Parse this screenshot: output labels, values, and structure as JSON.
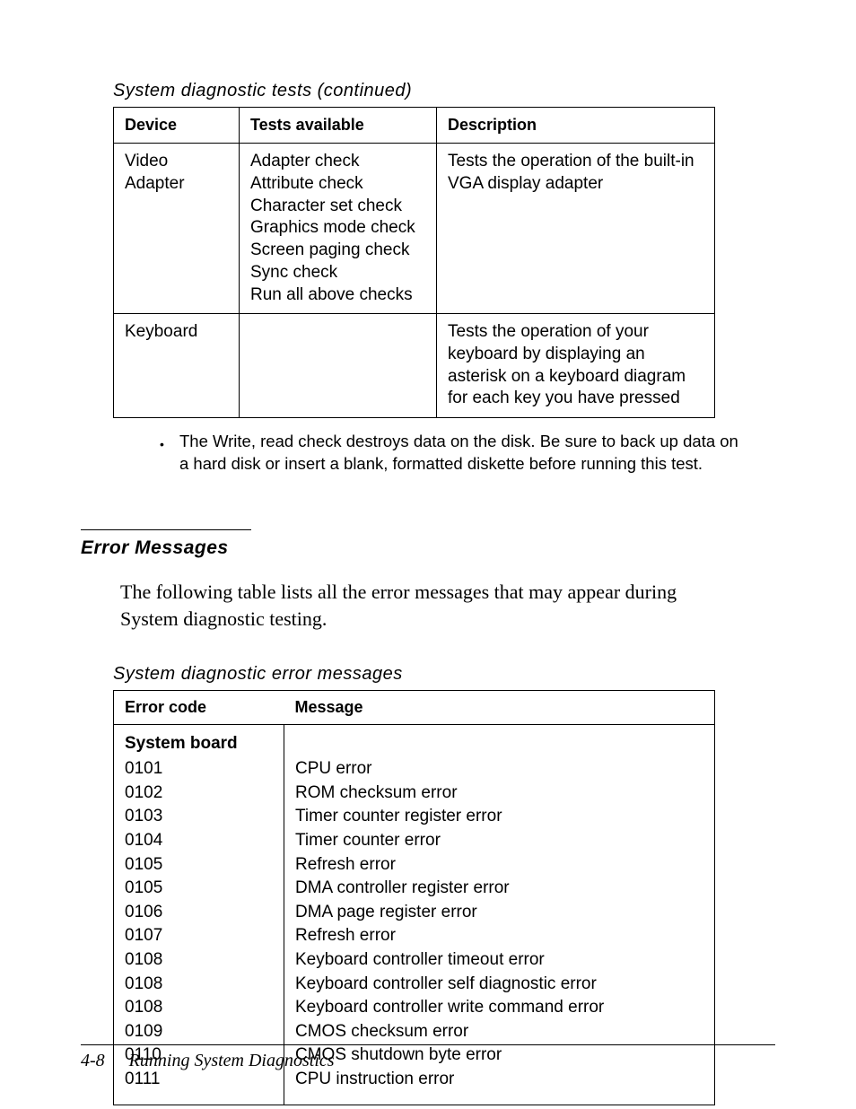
{
  "captions": {
    "tests_caption": "System diagnostic tests (continued)",
    "errors_caption": "System diagnostic error messages"
  },
  "tests_table": {
    "headers": {
      "device": "Device",
      "tests": "Tests available",
      "desc": "Description"
    },
    "rows": [
      {
        "device": "Video Adapter",
        "tests": "Adapter check\nAttribute check\nCharacter set check\nGraphics mode check\nScreen paging check\nSync check\nRun all above checks",
        "desc": "Tests the operation of the built-in VGA display adapter"
      },
      {
        "device": "Keyboard",
        "tests": "",
        "desc": "Tests the operation of your keyboard by displaying an asterisk on a keyboard diagram for each key you have pressed"
      }
    ]
  },
  "note_text": "The Write, read check destroys data on the disk. Be sure to back up data on a hard disk or insert a blank, formatted diskette before running this test.",
  "section": {
    "heading": "Error Messages",
    "body": "The following table lists all the error messages that may appear during System diagnostic testing."
  },
  "errors_table": {
    "headers": {
      "code": "Error code",
      "msg": "Message"
    },
    "section_label": "System board",
    "rows": [
      {
        "code": "0101",
        "msg": "CPU error"
      },
      {
        "code": "0102",
        "msg": "ROM checksum error"
      },
      {
        "code": "0103",
        "msg": "Timer counter register error"
      },
      {
        "code": "0104",
        "msg": "Timer counter error"
      },
      {
        "code": "0105",
        "msg": "Refresh error"
      },
      {
        "code": "0105",
        "msg": "DMA controller register error"
      },
      {
        "code": "0106",
        "msg": "DMA page register error"
      },
      {
        "code": "0107",
        "msg": "Refresh error"
      },
      {
        "code": "0108",
        "msg": "Keyboard controller timeout error"
      },
      {
        "code": "0108",
        "msg": "Keyboard controller self diagnostic error"
      },
      {
        "code": "0108",
        "msg": "Keyboard controller write command error"
      },
      {
        "code": "0109",
        "msg": "CMOS checksum error"
      },
      {
        "code": "0110",
        "msg": "CMOS shutdown byte error"
      },
      {
        "code": "0111",
        "msg": "CPU instruction error"
      }
    ]
  },
  "footer": {
    "page_number": "4-8",
    "title": "Running System Diagnostics"
  }
}
